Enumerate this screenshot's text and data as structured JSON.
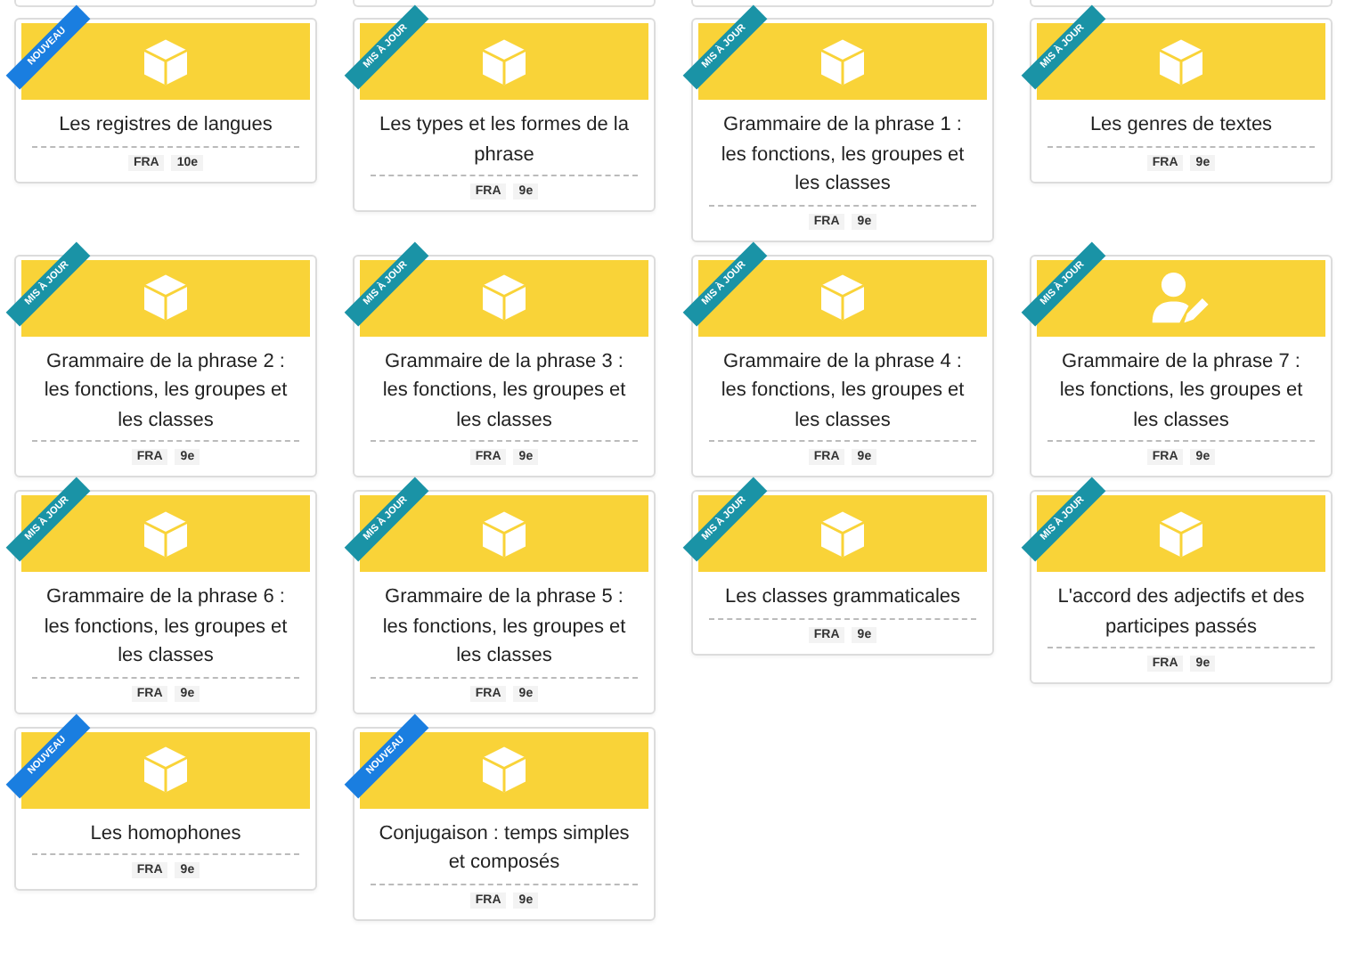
{
  "cards": [
    {
      "ribbon": {
        "kind": "new",
        "label": "NOUVEAU"
      },
      "kind": "module",
      "title": "Les registres de langues",
      "subject": "FRA",
      "grade": "10e"
    },
    {
      "ribbon": {
        "kind": "updated",
        "label": "MIS À JOUR"
      },
      "kind": "module",
      "title": "Les types et les formes de la phrase",
      "subject": "FRA",
      "grade": "9e"
    },
    {
      "ribbon": {
        "kind": "updated",
        "label": "MIS À JOUR"
      },
      "kind": "module",
      "title": "Grammaire de la phrase 1 : les fonctions, les groupes et les classes",
      "subject": "FRA",
      "grade": "9e"
    },
    {
      "ribbon": {
        "kind": "updated",
        "label": "MIS À JOUR"
      },
      "kind": "module",
      "title": "Les genres de textes",
      "subject": "FRA",
      "grade": "9e"
    },
    {
      "ribbon": {
        "kind": "updated",
        "label": "MIS À JOUR"
      },
      "kind": "module",
      "title": "Grammaire de la phrase 2 : les fonctions, les groupes et les classes",
      "subject": "FRA",
      "grade": "9e"
    },
    {
      "ribbon": {
        "kind": "updated",
        "label": "MIS À JOUR"
      },
      "kind": "module",
      "title": "Grammaire de la phrase 3 : les fonctions, les groupes et les classes",
      "subject": "FRA",
      "grade": "9e"
    },
    {
      "ribbon": {
        "kind": "updated",
        "label": "MIS À JOUR"
      },
      "kind": "module",
      "title": "Grammaire de la phrase 4 : les fonctions, les groupes et les classes",
      "subject": "FRA",
      "grade": "9e"
    },
    {
      "ribbon": {
        "kind": "updated",
        "label": "MIS À JOUR"
      },
      "kind": "task",
      "title": "Grammaire de la phrase 7 : les fonctions, les groupes et les classes",
      "subject": "FRA",
      "grade": "9e"
    },
    {
      "ribbon": {
        "kind": "updated",
        "label": "MIS À JOUR"
      },
      "kind": "module",
      "title": "Grammaire de la phrase 6 : les fonctions, les groupes et les classes",
      "subject": "FRA",
      "grade": "9e"
    },
    {
      "ribbon": {
        "kind": "updated",
        "label": "MIS À JOUR"
      },
      "kind": "module",
      "title": "Grammaire de la phrase 5 : les fonctions, les groupes et les classes",
      "subject": "FRA",
      "grade": "9e"
    },
    {
      "ribbon": {
        "kind": "updated",
        "label": "MIS À JOUR"
      },
      "kind": "module",
      "title": "Les classes grammaticales",
      "subject": "FRA",
      "grade": "9e"
    },
    {
      "ribbon": {
        "kind": "updated",
        "label": "MIS À JOUR"
      },
      "kind": "module",
      "title": "L'accord des adjectifs et des participes passés",
      "subject": "FRA",
      "grade": "9e"
    },
    {
      "ribbon": {
        "kind": "new",
        "label": "NOUVEAU"
      },
      "kind": "module",
      "title": "Les homophones",
      "subject": "FRA",
      "grade": "9e"
    },
    {
      "ribbon": {
        "kind": "new",
        "label": "NOUVEAU"
      },
      "kind": "module",
      "title": "Conjugaison : temps simples et composés",
      "subject": "FRA",
      "grade": "9e"
    }
  ]
}
